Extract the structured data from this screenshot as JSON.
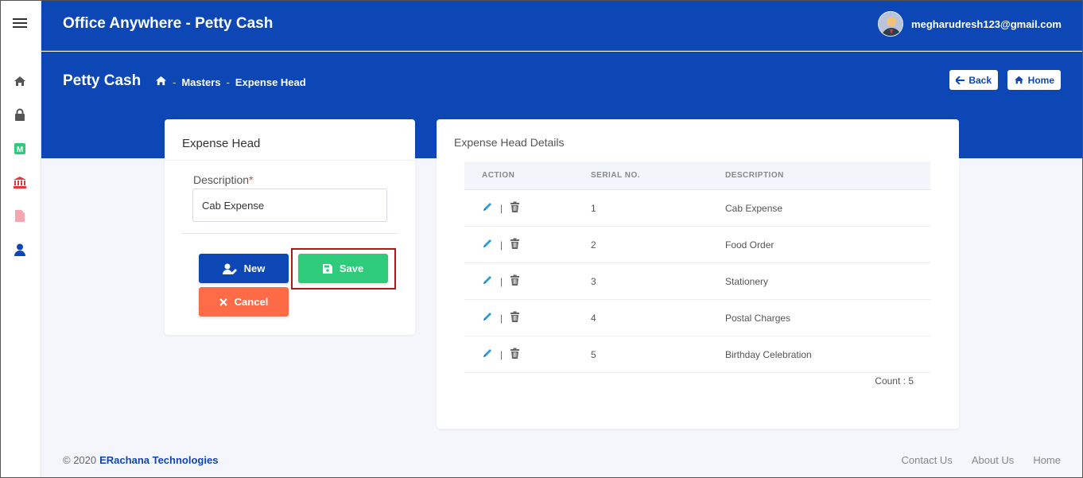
{
  "app": {
    "title": "Office Anywhere - Petty Cash",
    "user_email": "megharudresh123@gmail.com"
  },
  "header": {
    "page_title": "Petty Cash",
    "breadcrumb": [
      "Masters",
      "Expense Head"
    ],
    "back_label": "Back",
    "home_label": "Home"
  },
  "form": {
    "title": "Expense Head",
    "description_label": "Description",
    "description_value": "Cab Expense",
    "new_label": "New",
    "save_label": "Save",
    "cancel_label": "Cancel"
  },
  "details": {
    "title": "Expense Head Details",
    "columns": [
      "ACTION",
      "SERIAL NO.",
      "DESCRIPTION"
    ],
    "rows": [
      {
        "serial": "1",
        "description": "Cab Expense"
      },
      {
        "serial": "2",
        "description": "Food Order"
      },
      {
        "serial": "3",
        "description": "Stationery"
      },
      {
        "serial": "4",
        "description": "Postal Charges"
      },
      {
        "serial": "5",
        "description": "Birthday Celebration"
      }
    ],
    "count_label": "Count : 5"
  },
  "footer": {
    "copyright": "© 2020",
    "company": "ERachana Technologies",
    "links": [
      "Contact Us",
      "About Us",
      "Home"
    ]
  },
  "colors": {
    "brand": "#0d47b5",
    "new": "#0d47b5",
    "save": "#2ecc7a",
    "cancel": "#ff6b47",
    "highlight": "#b0181c"
  }
}
